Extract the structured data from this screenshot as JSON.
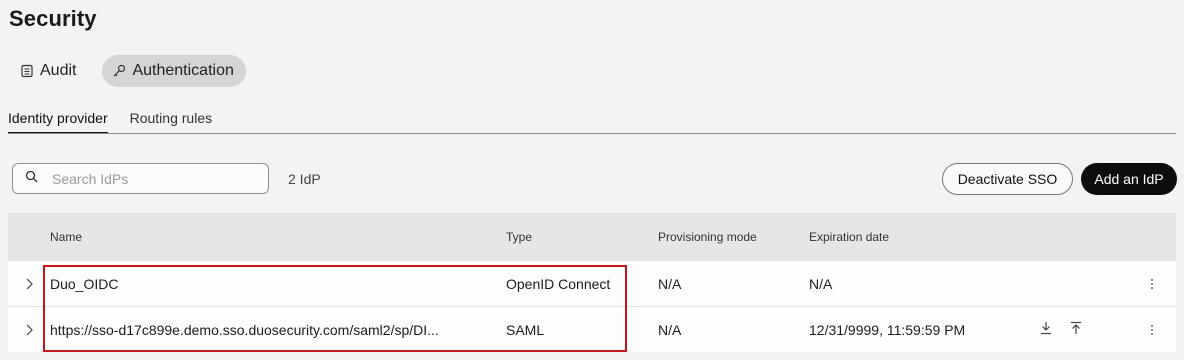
{
  "page": {
    "title": "Security"
  },
  "top_tabs": [
    {
      "label": "Audit",
      "icon": "document-icon"
    },
    {
      "label": "Authentication",
      "icon": "key-icon"
    }
  ],
  "sub_tabs": [
    {
      "label": "Identity provider"
    },
    {
      "label": "Routing rules"
    }
  ],
  "toolbar": {
    "search_placeholder": "Search IdPs",
    "count": "2 IdP",
    "deactivate_label": "Deactivate SSO",
    "add_label": "Add an IdP"
  },
  "table": {
    "columns": [
      "Name",
      "Type",
      "Provisioning mode",
      "Expiration date"
    ],
    "rows": [
      {
        "name": "Duo_OIDC",
        "type": "OpenID Connect",
        "provisioning": "N/A",
        "expiration": "N/A"
      },
      {
        "name": "https://sso-d17c899e.demo.sso.duosecurity.com/saml2/sp/DI...",
        "type": "SAML",
        "provisioning": "N/A",
        "expiration": "12/31/9999, 11:59:59 PM"
      }
    ]
  },
  "colors": {
    "accent_dark": "#0d0d0d",
    "highlight": "#c4161c",
    "active_pill": "#d5d5d5"
  }
}
